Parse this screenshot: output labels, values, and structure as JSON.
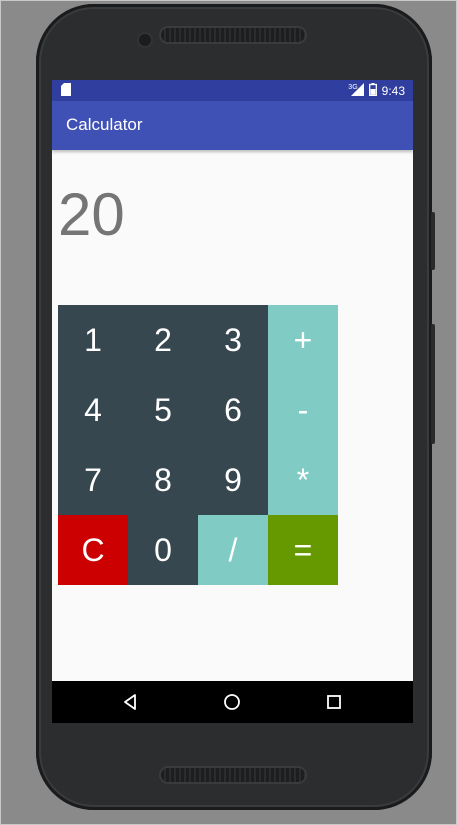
{
  "status_bar": {
    "network": "3G",
    "time": "9:43"
  },
  "app": {
    "title": "Calculator"
  },
  "display": {
    "value": "20"
  },
  "keypad": {
    "keys": [
      {
        "label": "1",
        "type": "digit"
      },
      {
        "label": "2",
        "type": "digit"
      },
      {
        "label": "3",
        "type": "digit"
      },
      {
        "label": "+",
        "type": "op"
      },
      {
        "label": "4",
        "type": "digit"
      },
      {
        "label": "5",
        "type": "digit"
      },
      {
        "label": "6",
        "type": "digit"
      },
      {
        "label": "-",
        "type": "op"
      },
      {
        "label": "7",
        "type": "digit"
      },
      {
        "label": "8",
        "type": "digit"
      },
      {
        "label": "9",
        "type": "digit"
      },
      {
        "label": "*",
        "type": "op"
      },
      {
        "label": "C",
        "type": "clear"
      },
      {
        "label": "0",
        "type": "digit"
      },
      {
        "label": "/",
        "type": "op"
      },
      {
        "label": "=",
        "type": "equals"
      }
    ]
  },
  "colors": {
    "status_bar": "#303f9f",
    "app_bar": "#3f51b5",
    "digit_key": "#37474f",
    "operator_key": "#80cbc4",
    "clear_key": "#cc0000",
    "equals_key": "#669900",
    "display_text": "#757575"
  },
  "icons": {
    "status_left": "sd-card-icon",
    "status_signal": "cell-signal-icon",
    "status_battery": "battery-icon",
    "nav_back": "back-triangle-icon",
    "nav_home": "home-circle-icon",
    "nav_recents": "recents-square-icon"
  }
}
